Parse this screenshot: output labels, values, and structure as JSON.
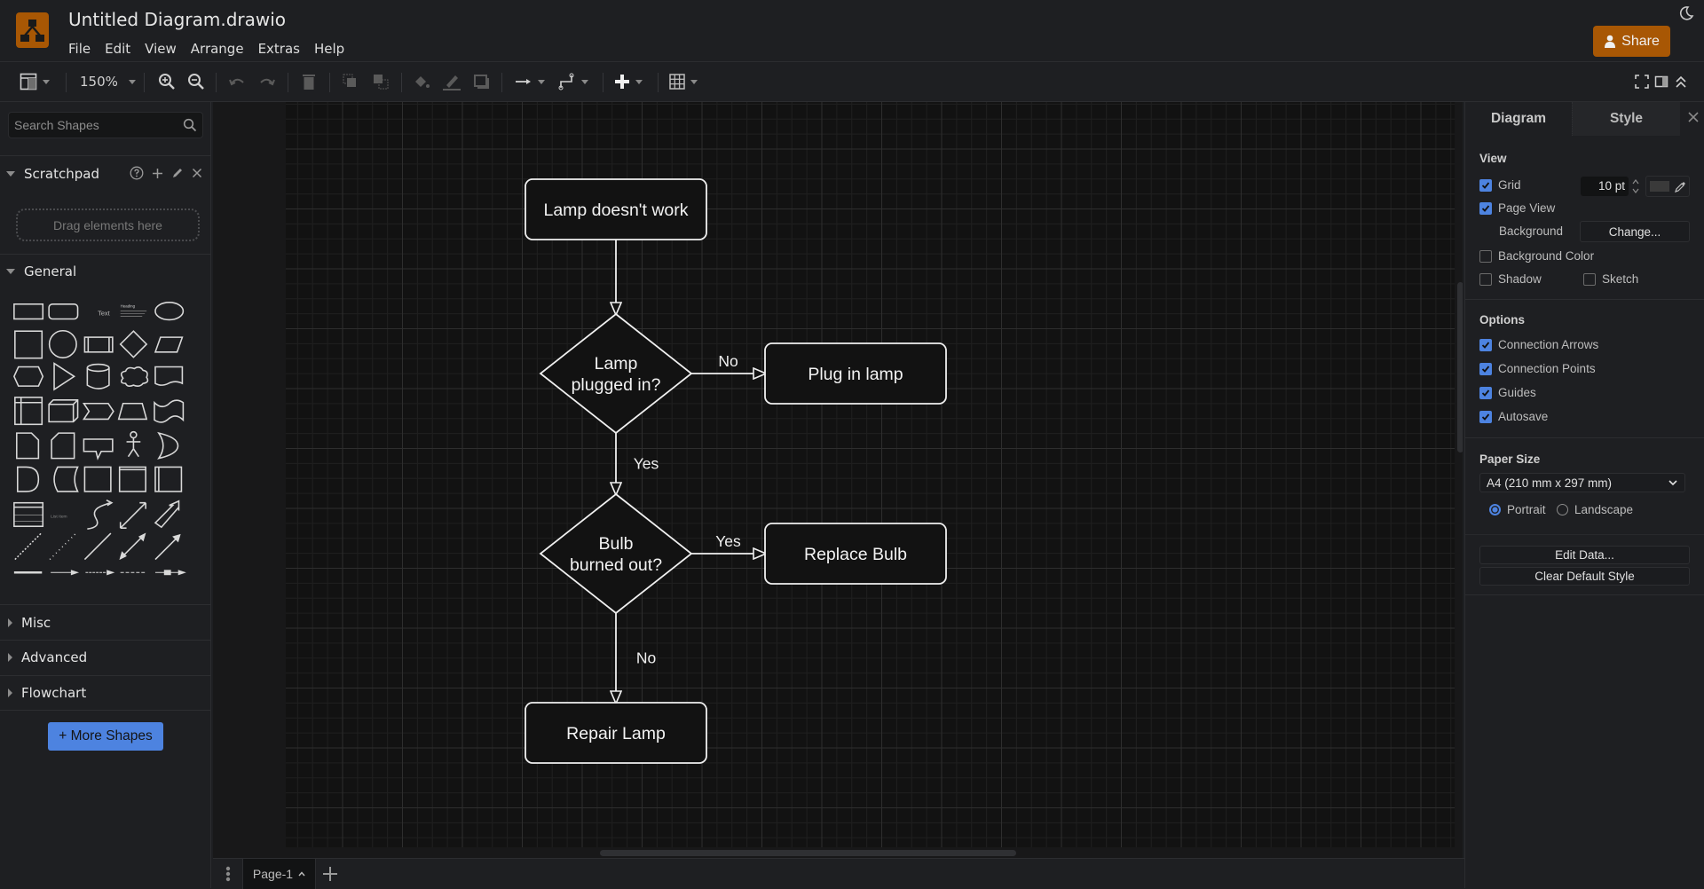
{
  "app": {
    "title": "Untitled Diagram.drawio",
    "logo_icon": "drawio-logo-icon",
    "theme_icon": "moon-icon",
    "share_label": "Share",
    "brand_color": "#a85704",
    "accent_color": "#4d83e0"
  },
  "menu": [
    "File",
    "Edit",
    "View",
    "Arrange",
    "Extras",
    "Help"
  ],
  "toolbar": {
    "zoom": "150%",
    "items": [
      {
        "name": "format-panel-toggle",
        "icon": "layout-icon"
      },
      {
        "name": "zoom-in",
        "icon": "zoom-in-icon"
      },
      {
        "name": "zoom-out",
        "icon": "zoom-out-icon"
      },
      {
        "name": "undo",
        "icon": "undo-icon",
        "enabled": false
      },
      {
        "name": "redo",
        "icon": "redo-icon",
        "enabled": false
      },
      {
        "name": "delete",
        "icon": "trash-icon",
        "enabled": false
      },
      {
        "name": "to-front",
        "icon": "to-front-icon",
        "enabled": false
      },
      {
        "name": "to-back",
        "icon": "to-back-icon",
        "enabled": false
      },
      {
        "name": "fill-color",
        "icon": "fill-icon",
        "enabled": false
      },
      {
        "name": "line-color",
        "icon": "pencil-icon",
        "enabled": false
      },
      {
        "name": "shadow",
        "icon": "shadow-icon",
        "enabled": false
      },
      {
        "name": "connection",
        "icon": "arrow-right-icon"
      },
      {
        "name": "waypoints",
        "icon": "waypoint-icon"
      },
      {
        "name": "insert",
        "icon": "plus-icon"
      },
      {
        "name": "table",
        "icon": "table-icon"
      },
      {
        "name": "fullscreen",
        "icon": "fullscreen-icon"
      },
      {
        "name": "format-panel",
        "icon": "panel-icon"
      },
      {
        "name": "collapse",
        "icon": "chevrons-up-icon"
      }
    ]
  },
  "sidebar": {
    "search_placeholder": "Search Shapes",
    "scratchpad": {
      "label": "Scratchpad",
      "drop_hint": "Drag elements here"
    },
    "general": {
      "label": "General"
    },
    "sections": [
      "Misc",
      "Advanced",
      "Flowchart"
    ],
    "more_shapes": "+ More Shapes",
    "shape_text": {
      "text": "Text",
      "heading": "Heading",
      "list_item": "List Item"
    }
  },
  "diagram": {
    "nodes": [
      {
        "id": "start",
        "type": "rounded-rect",
        "lines": [
          "Lamp doesn't work"
        ]
      },
      {
        "id": "q1",
        "type": "diamond",
        "lines": [
          "Lamp",
          "plugged in?"
        ]
      },
      {
        "id": "plug",
        "type": "rounded-rect",
        "lines": [
          "Plug in lamp"
        ]
      },
      {
        "id": "q2",
        "type": "diamond",
        "lines": [
          "Bulb",
          "burned out?"
        ]
      },
      {
        "id": "replace",
        "type": "rounded-rect",
        "lines": [
          "Replace Bulb"
        ]
      },
      {
        "id": "repair",
        "type": "rounded-rect",
        "lines": [
          "Repair Lamp"
        ]
      }
    ],
    "edges": [
      {
        "from": "start",
        "to": "q1",
        "label": ""
      },
      {
        "from": "q1",
        "to": "plug",
        "label": "No"
      },
      {
        "from": "q1",
        "to": "q2",
        "label": "Yes"
      },
      {
        "from": "q2",
        "to": "replace",
        "label": "Yes"
      },
      {
        "from": "q2",
        "to": "repair",
        "label": "No"
      }
    ]
  },
  "pages": {
    "current": "Page-1"
  },
  "panel": {
    "tabs": [
      "Diagram",
      "Style"
    ],
    "view": {
      "title": "View",
      "grid": {
        "label": "Grid",
        "checked": true,
        "size": "10 pt"
      },
      "page_view": {
        "label": "Page View",
        "checked": true
      },
      "background": {
        "label": "Background",
        "button": "Change..."
      },
      "background_color": {
        "label": "Background Color",
        "checked": false
      },
      "shadow": {
        "label": "Shadow",
        "checked": false
      },
      "sketch": {
        "label": "Sketch",
        "checked": false
      }
    },
    "options": {
      "title": "Options",
      "items": [
        {
          "label": "Connection Arrows",
          "checked": true
        },
        {
          "label": "Connection Points",
          "checked": true
        },
        {
          "label": "Guides",
          "checked": true
        },
        {
          "label": "Autosave",
          "checked": true
        }
      ]
    },
    "paper": {
      "title": "Paper Size",
      "selected": "A4 (210 mm x 297 mm)",
      "orientation": {
        "portrait": "Portrait",
        "landscape": "Landscape",
        "selected": "Portrait"
      }
    },
    "buttons": {
      "edit_data": "Edit Data...",
      "clear_style": "Clear Default Style"
    }
  }
}
